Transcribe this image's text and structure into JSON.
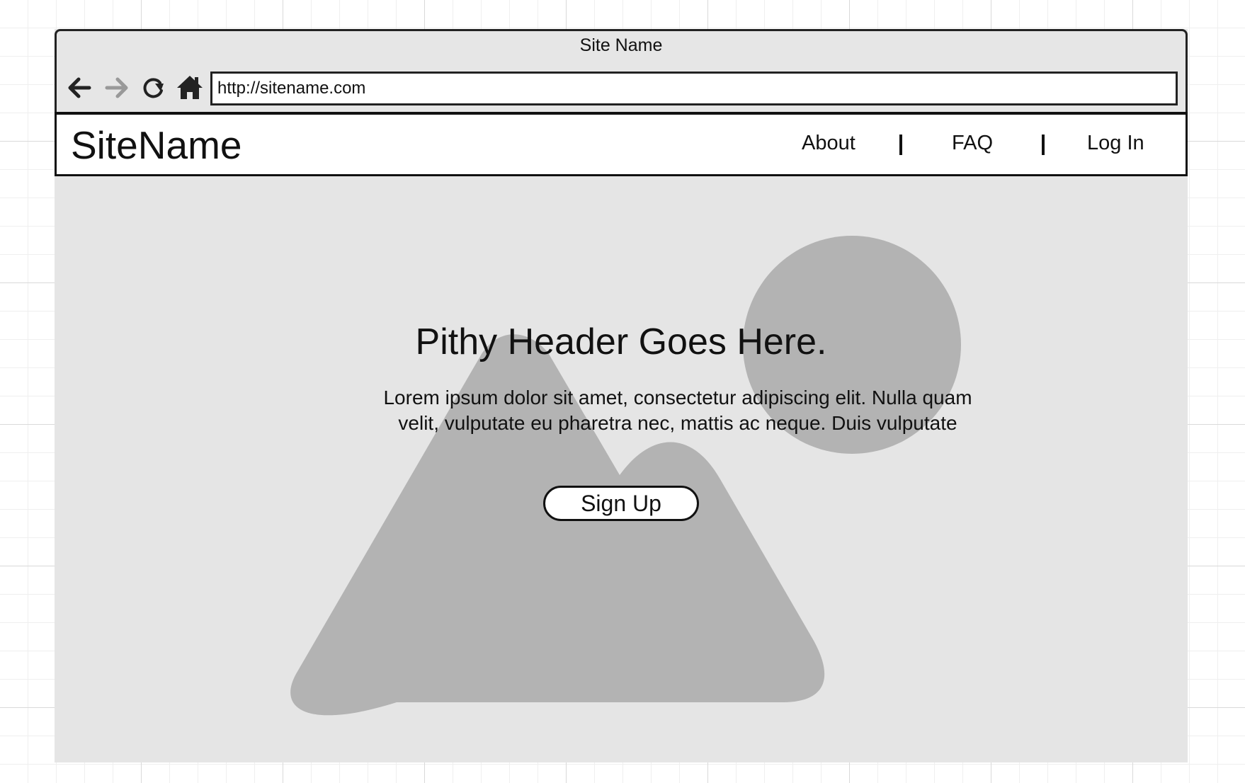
{
  "browser": {
    "window_title": "Site Name",
    "url": "http://sitename.com",
    "toolbar": {
      "back_icon": "arrow-left-icon",
      "forward_icon": "arrow-right-icon",
      "reload_icon": "reload-icon",
      "home_icon": "home-icon",
      "forward_enabled": false
    }
  },
  "site": {
    "logo": "SiteName",
    "nav": [
      {
        "label": "About"
      },
      {
        "label": "FAQ"
      },
      {
        "label": "Log In"
      }
    ]
  },
  "hero": {
    "title": "Pithy Header Goes Here.",
    "text_line1": "Lorem ipsum dolor sit amet, consectetur adipiscing elit. Nulla quam",
    "text_line2": "velit, vulputate eu pharetra nec, mattis ac neque. Duis vulputate",
    "cta_label": "Sign Up",
    "image_placeholder_icon": "image-placeholder-icon"
  },
  "colors": {
    "page_background": "#e5e5e5",
    "chrome_background": "#e6e6e6",
    "placeholder_shape": "#b3b3b3",
    "stroke": "#111111",
    "disabled_icon": "#999999"
  }
}
